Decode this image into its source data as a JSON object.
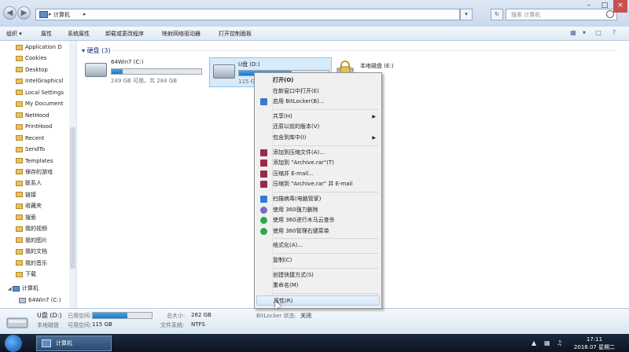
{
  "address": {
    "crumb": "计算机",
    "search_placeholder": "搜索 计算机"
  },
  "commandbar": {
    "items": [
      "组织",
      "属性",
      "系统属性",
      "卸载或更改程序",
      "映射网络驱动器",
      "打开控制面板"
    ]
  },
  "navpane": {
    "items": [
      "Application D",
      "Cookies",
      "Desktop",
      "IntelGraphicsl",
      "Local Settings",
      "My Document",
      "NetHood",
      "PrintHood",
      "Recent",
      "SendTo",
      "Templates",
      "保存的游戏",
      "联系人",
      "链接",
      "收藏夹",
      "搜索",
      "我的视频",
      "我的图片",
      "我的文档",
      "我的音乐",
      "下载"
    ],
    "computer": "计算机",
    "drive": "64Win7  (C:)"
  },
  "content": {
    "group_header": "硬盘 (3)",
    "drives": [
      {
        "name": "64Win7  (C:)",
        "size": "249 GB 可用，共 284 GB",
        "used": 0.12
      },
      {
        "name": "U盘 (D:)",
        "size": "115 G",
        "used": 0.59
      },
      {
        "name": "本地磁盘 (E:)"
      }
    ]
  },
  "context_menu": {
    "items": [
      {
        "label": "打开(O)",
        "bold": true
      },
      {
        "label": "在新窗口中打开(E)"
      },
      {
        "label": "启用 BitLocker(B)...",
        "icon": "shield-icon"
      },
      {
        "sep": true
      },
      {
        "label": "共享(H)",
        "submenu": true
      },
      {
        "label": "还原以前的版本(V)"
      },
      {
        "label": "包含到库中(I)",
        "submenu": true
      },
      {
        "sep": true
      },
      {
        "label": "添加到压缩文件(A)...",
        "icon": "winrar-icon"
      },
      {
        "label": "添加到 \"Archive.rar\"(T)",
        "icon": "winrar-icon"
      },
      {
        "label": "压缩并 E-mail...",
        "icon": "winrar-icon"
      },
      {
        "label": "压缩到 \"Archive.rar\" 并 E-mail",
        "icon": "winrar-icon"
      },
      {
        "sep": true
      },
      {
        "label": "扫描病毒(电脑管家)",
        "icon": "shield-blue-icon"
      },
      {
        "label": "使用 360强力删除",
        "icon": "360-delete-icon"
      },
      {
        "label": "使用 360进行木马云查杀",
        "icon": "360-scan-icon"
      },
      {
        "label": "使用 360管理右键菜单",
        "icon": "360-manage-icon"
      },
      {
        "sep": true
      },
      {
        "label": "格式化(A)..."
      },
      {
        "sep": true
      },
      {
        "label": "复制(C)"
      },
      {
        "sep": true
      },
      {
        "label": "创建快捷方式(S)"
      },
      {
        "label": "重命名(M)"
      },
      {
        "sep": true
      },
      {
        "label": "属性(R)",
        "hover": true
      }
    ]
  },
  "details": {
    "name": "U盘 (D:)",
    "used_label": "已用空间:",
    "used_fraction": 0.59,
    "free_label": "可用空间:",
    "free_value": "115 GB",
    "type": "本地磁盘",
    "total_label": "总大小:",
    "total_value": "282 GB",
    "fs_label": "文件系统:",
    "fs_value": "NTFS",
    "bitlocker_label": "BitLocker 状态:",
    "bitlocker_value": "关闭"
  },
  "taskbar": {
    "window_button": "计算机",
    "time": "17:11",
    "date": "2018.07 星期二"
  },
  "colors": {
    "accent": "#1a78c8",
    "selection": "#d7ebfb",
    "menu_bg": "#f0f0f0"
  }
}
